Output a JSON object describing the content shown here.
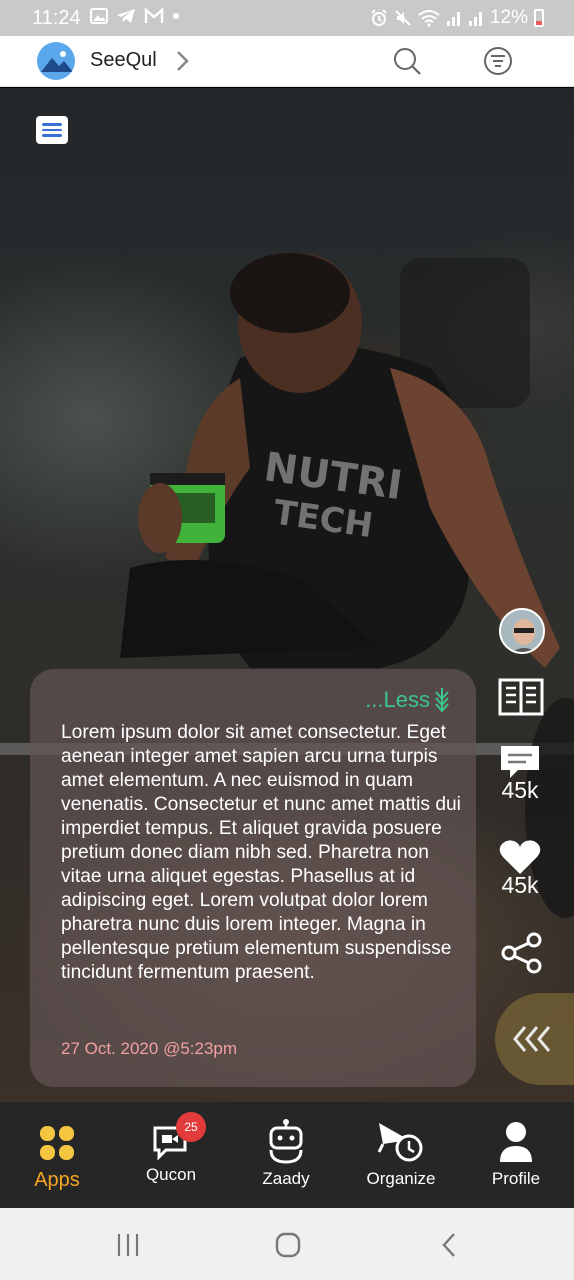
{
  "status_bar": {
    "time": "11:24",
    "battery": "12%"
  },
  "header": {
    "app_name": "SeeQul"
  },
  "post": {
    "less_label": "...Less",
    "body": "Lorem ipsum dolor sit amet consectetur. Eget aenean integer amet sapien arcu urna turpis amet elementum. A nec euismod in quam venenatis. Consectetur et nunc amet mattis dui imperdiet tempus. Et aliquet gravida posuere pretium donec diam nibh sed. Pharetra non vitae urna aliquet egestas. Phasellus at id adipiscing eget. Lorem volutpat dolor lorem pharetra nunc duis lorem integer. Magna in pellentesque pretium elementum suspendisse tincidunt fermentum praesent.",
    "timestamp": "27 Oct. 2020 @5:23pm"
  },
  "actions": {
    "comments_count": "45k",
    "likes_count": "45k"
  },
  "tabs": [
    {
      "label": "Apps",
      "active": true
    },
    {
      "label": "Qucon",
      "badge": "25"
    },
    {
      "label": "Zaady"
    },
    {
      "label": "Organize"
    },
    {
      "label": "Profile"
    }
  ],
  "colors": {
    "accent": "#f5a623",
    "less": "#3ec48a",
    "badge": "#e23b3b",
    "timestamp": "#f2a0a0"
  }
}
